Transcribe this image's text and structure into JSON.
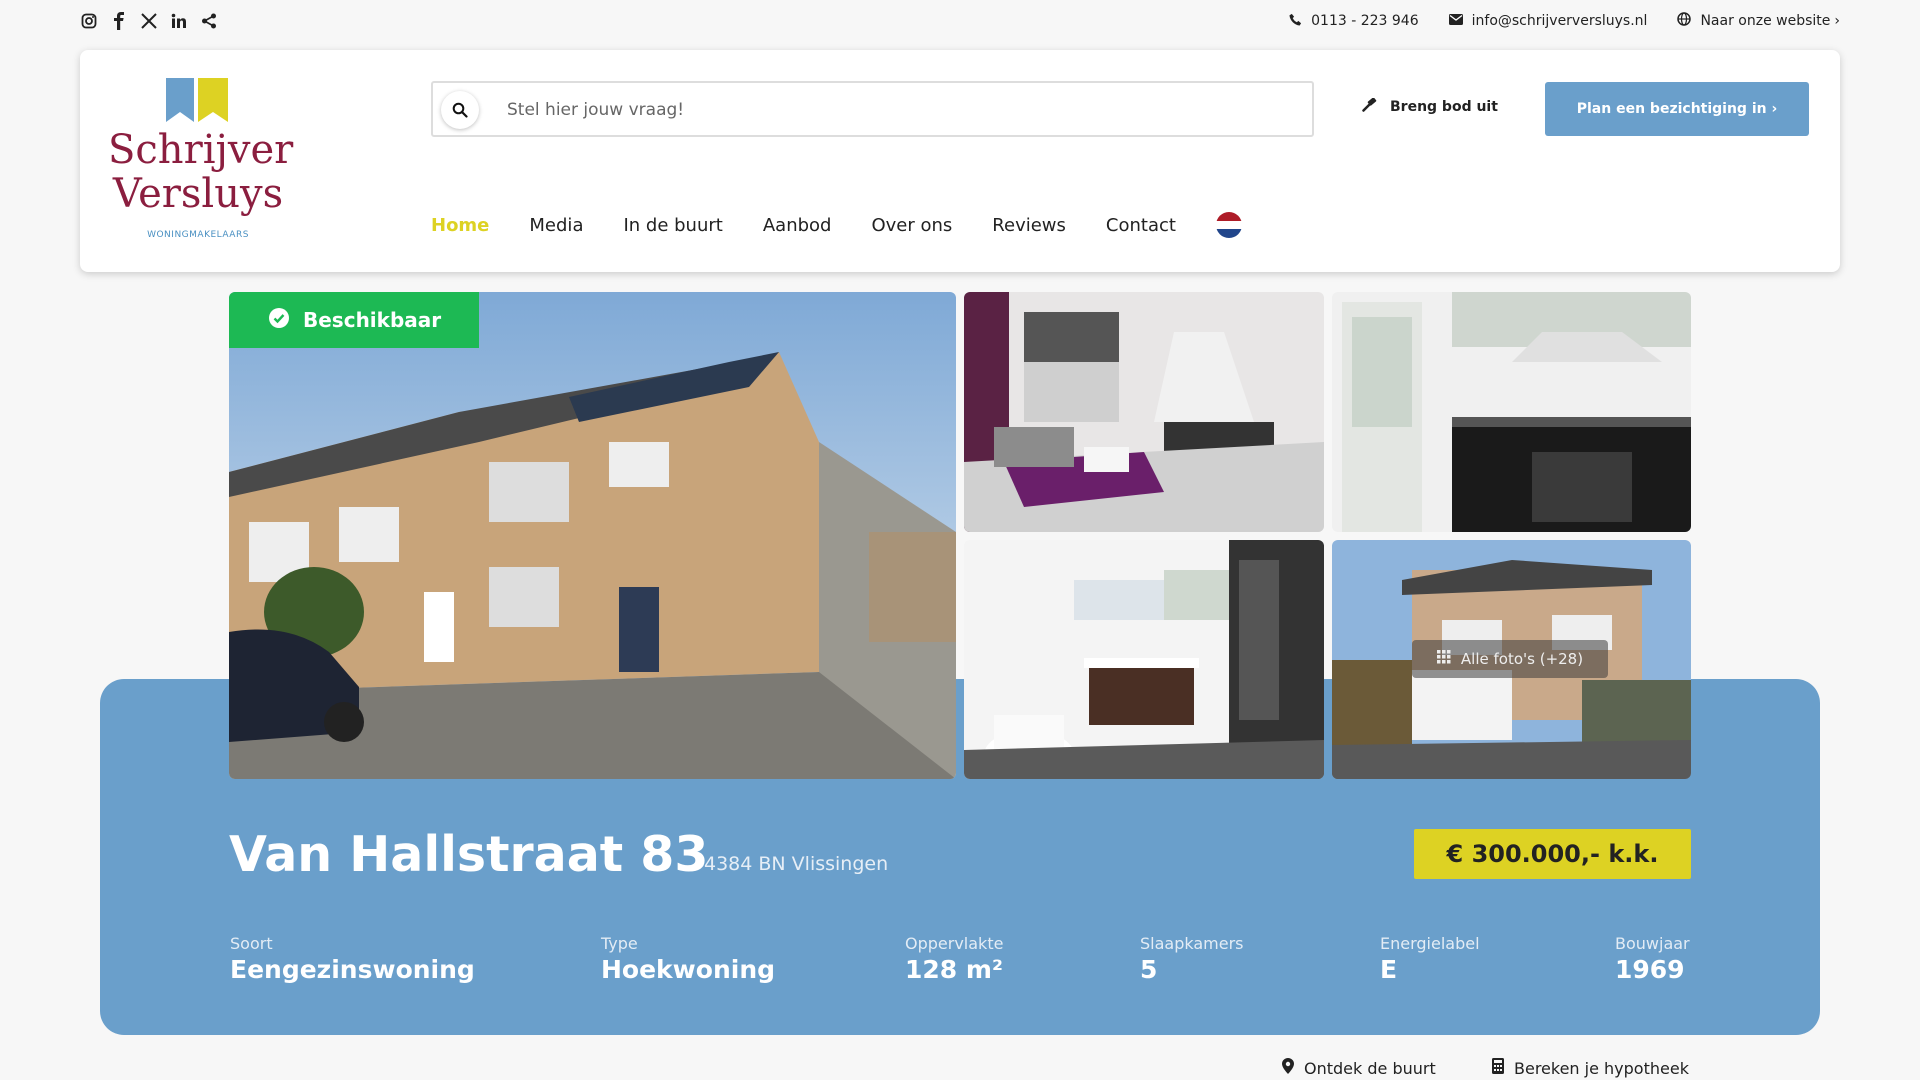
{
  "topbar": {
    "social_icons": [
      "instagram-icon",
      "facebook-icon",
      "x-icon",
      "linkedin-icon",
      "share-icon"
    ],
    "phone": "0113 - 223 946",
    "email": "info@schrijverversluys.nl",
    "website_label": "Naar onze website"
  },
  "logo": {
    "line1": "Schrijver",
    "line2": "Versluys",
    "tagline": "WONINGMAKELAARS",
    "colors": {
      "blue": "#6a9fcb",
      "yellow": "#ddd223",
      "wine": "#8b1e3f"
    }
  },
  "search": {
    "placeholder": "Stel hier jouw vraag!"
  },
  "actions": {
    "bid_label": "Breng bod uit",
    "viewing_label": "Plan een bezichtiging in ›"
  },
  "nav": {
    "items": [
      {
        "label": "Home",
        "active": true
      },
      {
        "label": "Media"
      },
      {
        "label": "In de buurt"
      },
      {
        "label": "Aanbod"
      },
      {
        "label": "Over ons"
      },
      {
        "label": "Reviews"
      },
      {
        "label": "Contact"
      }
    ],
    "language": "nl-flag-icon"
  },
  "listing": {
    "status": "Beschikbaar",
    "all_photos_label": "Alle foto's (+28)",
    "address": "Van Hallstraat 83",
    "postcode_city": "4384 BN Vlissingen",
    "price": "€ 300.000,- k.k.",
    "specs": [
      {
        "label": "Soort",
        "value": "Eengezinswoning"
      },
      {
        "label": "Type",
        "value": "Hoekwoning"
      },
      {
        "label": "Oppervlakte",
        "value": "128 m²"
      },
      {
        "label": "Slaapkamers",
        "value": "5"
      },
      {
        "label": "Energielabel",
        "value": "E"
      },
      {
        "label": "Bouwjaar",
        "value": "1969"
      }
    ]
  },
  "links": {
    "neighbourhood": "Ontdek de buurt",
    "mortgage": "Bereken je hypotheek"
  },
  "colors": {
    "accent_blue": "#6a9fcb",
    "accent_yellow": "#ddd223",
    "available_green": "#1db954"
  }
}
